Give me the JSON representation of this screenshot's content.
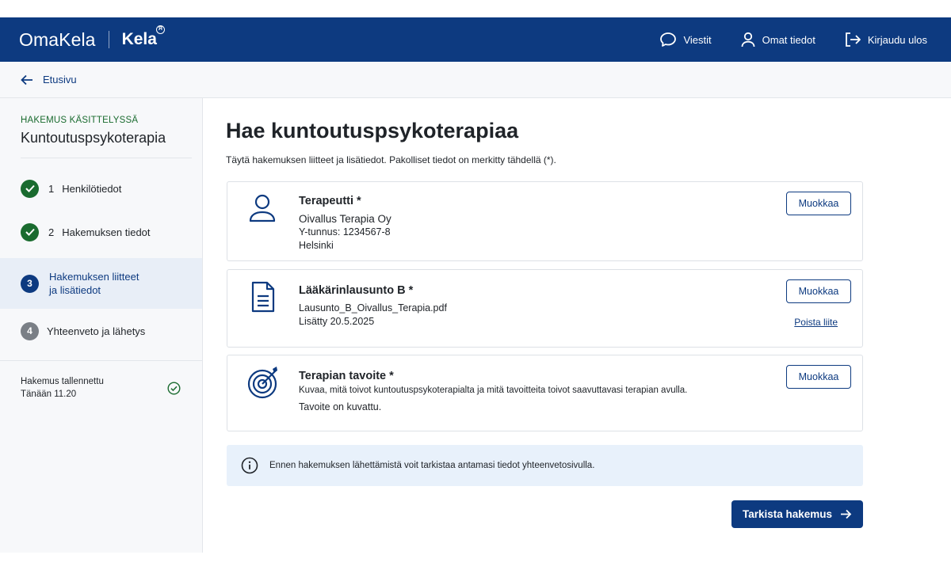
{
  "header": {
    "brand": "OmaKela",
    "kela_logo": "Kela",
    "nav": {
      "messages": "Viestit",
      "profile": "Omat tiedot",
      "logout": "Kirjaudu ulos"
    }
  },
  "breadcrumb": {
    "back_label": "Etusivu"
  },
  "sidebar": {
    "status": "HAKEMUS KÄSITTELYSSÄ",
    "title": "Kuntoutuspsykoterapia",
    "steps": [
      {
        "number": "1",
        "label": "Henkilötiedot",
        "state": "done"
      },
      {
        "number": "2",
        "label": "Hakemuksen tiedot",
        "state": "done"
      },
      {
        "number": "3",
        "label_line1": "Hakemuksen liitteet",
        "label_line2": "ja lisätiedot",
        "state": "active"
      },
      {
        "number": "4",
        "label": "Yhteenveto ja lähetys",
        "state": "pending"
      }
    ],
    "saved": {
      "line1": "Hakemus tallennettu",
      "line2": "Tänään 11.20"
    }
  },
  "main": {
    "title": "Hae kuntoutuspsykoterapiaa",
    "intro": "Täytä hakemuksen liitteet ja lisätiedot. Pakolliset tiedot on merkitty tähdellä (*).",
    "cards": [
      {
        "icon": "person-icon",
        "title": "Terapeutti *",
        "lines": [
          "Oivallus Terapia Oy",
          "Y-tunnus: 1234567-8",
          "Helsinki"
        ],
        "edit_label": "Muokkaa"
      },
      {
        "icon": "document-icon",
        "title": "Lääkärinlausunto B *",
        "lines": [
          "Lausunto_B_Oivallus_Terapia.pdf",
          "Lisätty  20.5.2025"
        ],
        "edit_label": "Muokkaa",
        "remove_label": "Poista liite"
      },
      {
        "icon": "target-icon",
        "title": "Terapian tavoite *",
        "description": "Kuvaa, mitä toivot kuntoutuspsykoterapialta ja mitä tavoitteita toivot saavuttavasi terapian avulla.",
        "status": "Tavoite on kuvattu.",
        "edit_label": "Muokkaa"
      }
    ],
    "info": "Ennen hakemuksen lähettämistä voit tarkistaa antamasi tiedot yhteenvetosivulla.",
    "primary_button": "Tarkista hakemus"
  },
  "colors": {
    "brand_blue": "#0d3a80",
    "success_green": "#1a6b2f",
    "step_pending": "#7a7f86",
    "info_bg": "#e8f1fb"
  }
}
